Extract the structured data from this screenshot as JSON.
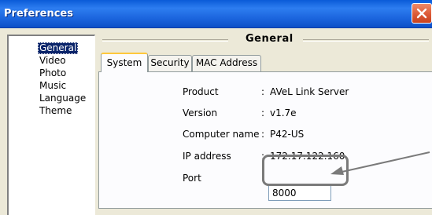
{
  "window": {
    "title": "Preferences",
    "close_icon": "close-icon",
    "titlebar_color": "#0a5bd8",
    "close_color": "#dc5a37"
  },
  "sidebar": {
    "items": [
      {
        "label": "General",
        "selected": true
      },
      {
        "label": "Video",
        "selected": false
      },
      {
        "label": "Photo",
        "selected": false
      },
      {
        "label": "Music",
        "selected": false
      },
      {
        "label": "Language",
        "selected": false
      },
      {
        "label": "Theme",
        "selected": false
      }
    ]
  },
  "section": {
    "title": "General"
  },
  "tabs": [
    {
      "label": "System",
      "active": true
    },
    {
      "label": "Security",
      "active": false
    },
    {
      "label": "MAC Address",
      "active": false
    }
  ],
  "system": {
    "colon": ":",
    "fields": [
      {
        "label": "Product",
        "value": "AVeL Link Server"
      },
      {
        "label": "Version",
        "value": "v1.7e"
      },
      {
        "label": "Computer name",
        "value": "P42-US"
      },
      {
        "label": "IP address",
        "value": "172.17.122.160"
      }
    ],
    "port": {
      "label": "Port",
      "value": "8000"
    }
  },
  "annotation": {
    "highlight_color": "#7a7a7a",
    "arrow_icon": "arrow-icon"
  }
}
